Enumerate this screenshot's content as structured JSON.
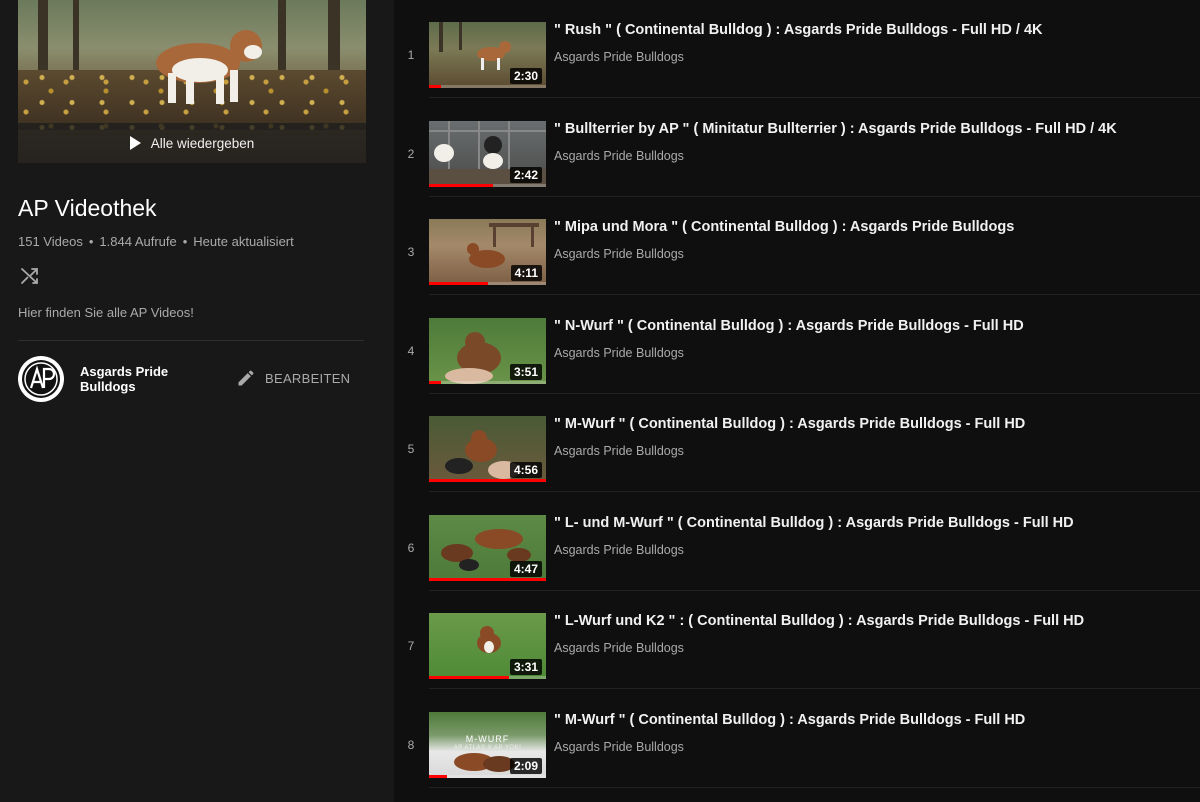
{
  "playlist": {
    "play_all_label": "Alle wiedergeben",
    "title": "AP Videothek",
    "video_count": "151 Videos",
    "views": "1.844 Aufrufe",
    "updated": "Heute aktualisiert",
    "description": "Hier finden Sie alle AP Videos!",
    "owner_line1": "Asgards Pride",
    "owner_line2": "Bulldogs",
    "edit_label": "BEARBEITEN",
    "avatar_letters": "AP"
  },
  "videos": [
    {
      "index": "1",
      "title": "\" Rush \" ( Continental Bulldog ) : Asgards Pride Bulldogs - Full HD / 4K",
      "channel": "Asgards Pride Bulldogs",
      "duration": "2:30",
      "progress": 0.1
    },
    {
      "index": "2",
      "title": "\" Bullterrier by AP \" ( Minitatur Bullterrier ) : Asgards Pride Bulldogs - Full HD / 4K",
      "channel": "Asgards Pride Bulldogs",
      "duration": "2:42",
      "progress": 0.55
    },
    {
      "index": "3",
      "title": "\" Mipa und Mora \" ( Continental Bulldog ) : Asgards Pride Bulldogs",
      "channel": "Asgards Pride Bulldogs",
      "duration": "4:11",
      "progress": 0.5
    },
    {
      "index": "4",
      "title": "\" N-Wurf \" ( Continental Bulldog ) : Asgards Pride Bulldogs - Full HD",
      "channel": "Asgards Pride Bulldogs",
      "duration": "3:51",
      "progress": 0.1
    },
    {
      "index": "5",
      "title": "\" M-Wurf \" ( Continental Bulldog ) : Asgards Pride Bulldogs - Full HD",
      "channel": "Asgards Pride Bulldogs",
      "duration": "4:56",
      "progress": 1.0
    },
    {
      "index": "6",
      "title": "\" L- und M-Wurf \" ( Continental Bulldog ) : Asgards Pride Bulldogs - Full HD",
      "channel": "Asgards Pride Bulldogs",
      "duration": "4:47",
      "progress": 1.0
    },
    {
      "index": "7",
      "title": "\" L-Wurf und K2 \" : ( Continental Bulldog ) : Asgards Pride Bulldogs - Full HD",
      "channel": "Asgards Pride Bulldogs",
      "duration": "3:31",
      "progress": 0.68
    },
    {
      "index": "8",
      "title": "\" M-Wurf \" ( Continental Bulldog ) : Asgards Pride Bulldogs - Full HD",
      "channel": "Asgards Pride Bulldogs",
      "duration": "2:09",
      "progress": 0.15,
      "overlay_title": "M-WURF",
      "overlay_sub": "AP ATLAS X AP YOKI"
    }
  ],
  "colors": {
    "background": "#0f0f0f",
    "sidebar": "#181818",
    "progress": "#ff0000",
    "secondary_text": "#aaaaaa"
  }
}
